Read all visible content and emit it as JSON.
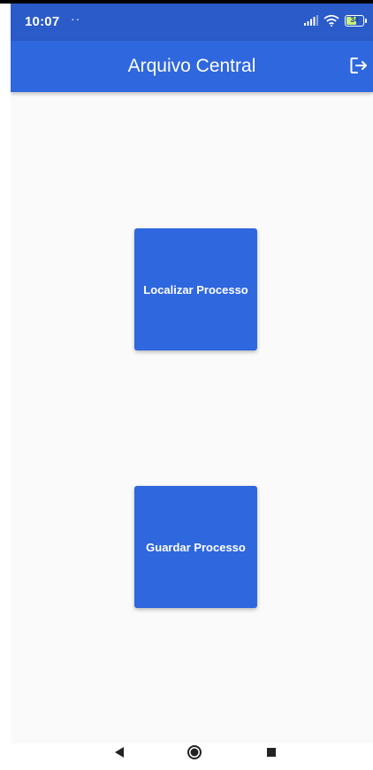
{
  "status_bar": {
    "time": "10:07",
    "dots": "··",
    "battery": "34"
  },
  "app_bar": {
    "title": "Arquivo Central",
    "logout_icon": "logout-icon"
  },
  "main": {
    "buttons": [
      {
        "label": "Localizar Processo"
      },
      {
        "label": "Guardar Processo"
      }
    ]
  },
  "nav_bar": {
    "icons": [
      "back-triangle-icon",
      "home-circle-icon",
      "recents-square-icon"
    ]
  },
  "colors": {
    "primary": "#2f67de",
    "status_bar": "#2a5bc9",
    "background": "#fafafa"
  }
}
